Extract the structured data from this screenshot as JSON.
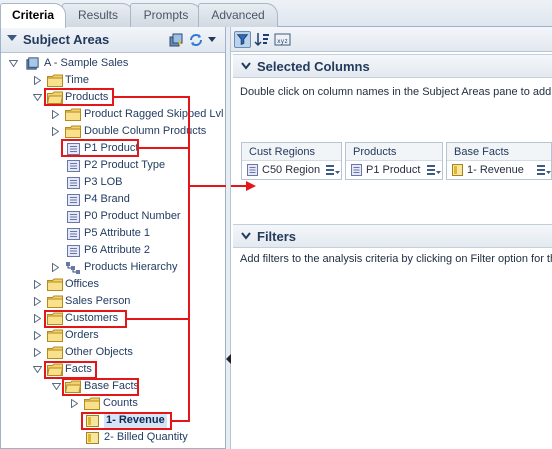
{
  "tabs": [
    {
      "label": "Criteria",
      "active": true
    },
    {
      "label": "Results",
      "active": false
    },
    {
      "label": "Prompts",
      "active": false
    },
    {
      "label": "Advanced",
      "active": false
    }
  ],
  "left_panel": {
    "title": "Subject Areas",
    "icons": [
      "subject-area-icon",
      "refresh-icon",
      "menu-dropdown-icon"
    ]
  },
  "tree": [
    {
      "label": "A - Sample Sales",
      "type": "subject-area",
      "expanded": true
    },
    {
      "label": "Time",
      "type": "folder",
      "expanded": false
    },
    {
      "label": "Products",
      "type": "folder",
      "expanded": true,
      "highlight": true
    },
    {
      "label": "Product Ragged Skipped Lvl",
      "type": "folder",
      "expanded": false
    },
    {
      "label": "Double Column Products",
      "type": "folder",
      "expanded": false
    },
    {
      "label": "P1 Product",
      "type": "column",
      "highlight": true
    },
    {
      "label": "P2 Product Type",
      "type": "column"
    },
    {
      "label": "P3 LOB",
      "type": "column"
    },
    {
      "label": "P4 Brand",
      "type": "column"
    },
    {
      "label": "P0 Product Number",
      "type": "column"
    },
    {
      "label": "P5 Attribute 1",
      "type": "column"
    },
    {
      "label": "P6 Attribute 2",
      "type": "column"
    },
    {
      "label": "Products Hierarchy",
      "type": "hierarchy",
      "expanded": false
    },
    {
      "label": "Offices",
      "type": "folder",
      "expanded": false
    },
    {
      "label": "Sales Person",
      "type": "folder",
      "expanded": false
    },
    {
      "label": "Customers",
      "type": "folder",
      "expanded": false,
      "highlight": true
    },
    {
      "label": "Orders",
      "type": "folder",
      "expanded": false
    },
    {
      "label": "Other Objects",
      "type": "folder",
      "expanded": false
    },
    {
      "label": "Facts",
      "type": "folder",
      "expanded": true,
      "highlight": true
    },
    {
      "label": "Base Facts",
      "type": "folder",
      "expanded": true,
      "highlight": true
    },
    {
      "label": "Counts",
      "type": "folder",
      "expanded": false
    },
    {
      "label": "1- Revenue",
      "type": "measure",
      "highlight": true,
      "selected": true
    },
    {
      "label": "2- Billed Quantity",
      "type": "measure"
    }
  ],
  "toolbar": {
    "icons": [
      "filter-icon",
      "sort-icon",
      "column-formula-icon"
    ]
  },
  "selected_columns": {
    "title": "Selected Columns",
    "description": "Double click on column names in the Subject Areas pane to add th",
    "columns": [
      {
        "header": "Cust Regions",
        "label": "C50 Region",
        "icon": "attribute-column-icon"
      },
      {
        "header": "Products",
        "label": "P1 Product",
        "icon": "attribute-column-icon"
      },
      {
        "header": "Base Facts",
        "label": "1- Revenue",
        "icon": "measure-column-icon"
      }
    ]
  },
  "filters": {
    "title": "Filters",
    "description": "Add filters to the analysis criteria by clicking on Filter option for th"
  },
  "colors": {
    "highlight_red": "#e3171a",
    "folder_yellow": "#f2d26b",
    "link_blue": "#1f3a5f"
  }
}
